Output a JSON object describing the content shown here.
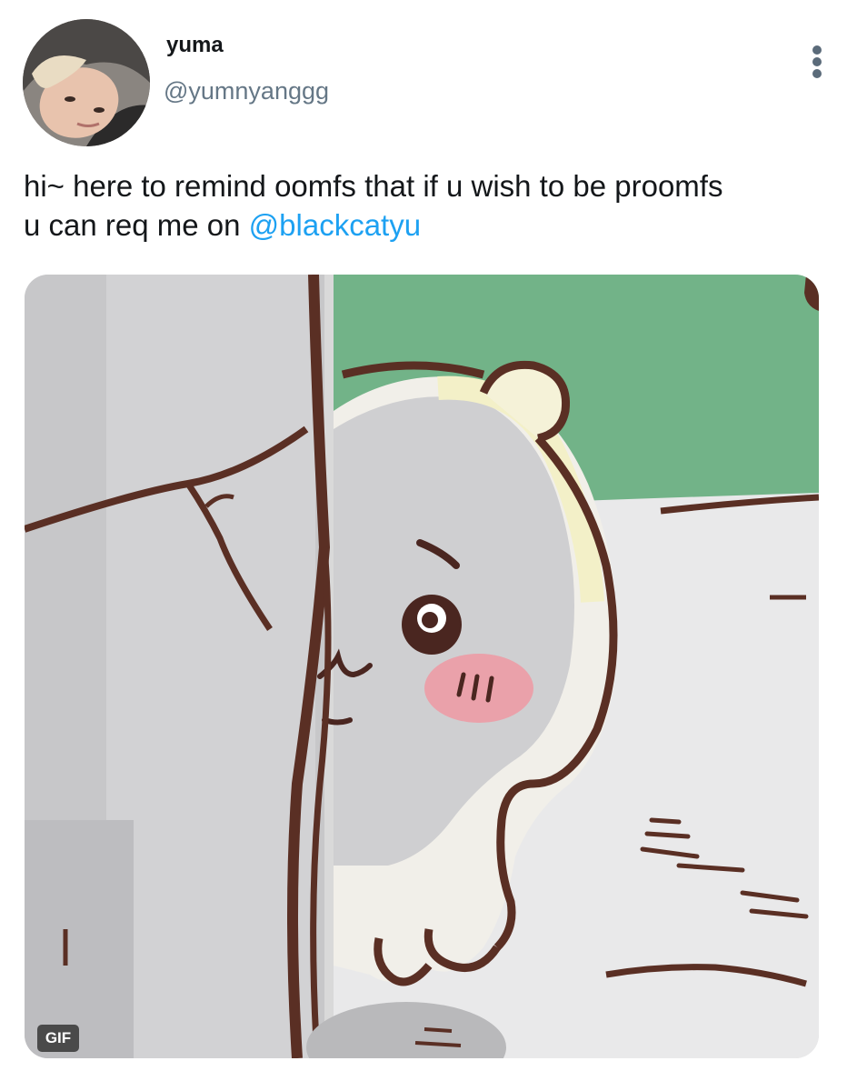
{
  "tweet": {
    "author": {
      "display_name": "yuma",
      "handle": "@yumnyanggg",
      "avatar_icon": "profile-photo"
    },
    "more_icon": "vertical-ellipsis-icon",
    "text_before_mention": "hi~ here to remind oomfs that if u wish to be proomfs\nu can req me on ",
    "mention": "@blackcatyu",
    "media": {
      "badge": "GIF"
    }
  },
  "colors": {
    "text": "#14171a",
    "secondary_text": "#657786",
    "link": "#1da1f2",
    "badge_bg": "#4a4a4a"
  }
}
